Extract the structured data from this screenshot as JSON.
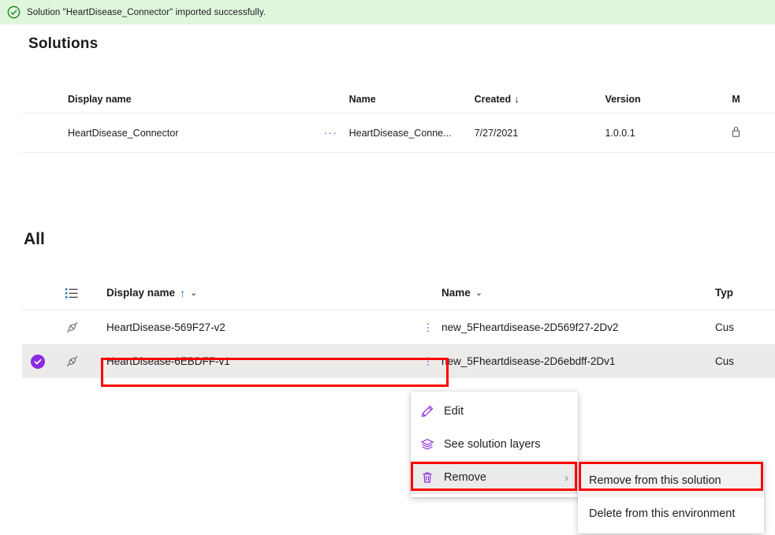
{
  "banner": {
    "icon": "check-circle-outline-icon",
    "message": "Solution \"HeartDisease_Connector\" imported successfully.",
    "background": "#dff6dd"
  },
  "page": {
    "title": "Solutions"
  },
  "solutions_table": {
    "columns": [
      "Display name",
      "Name",
      "Created",
      "Version",
      "M"
    ],
    "sort_indicator": "↓",
    "rows": [
      {
        "display_name": "HeartDisease_Connector",
        "overflow": "···",
        "name": "HeartDisease_Conne...",
        "created": "7/27/2021",
        "version": "1.0.0.1",
        "managed": ""
      }
    ]
  },
  "all_section": {
    "title": "All",
    "columns": {
      "sort_icon": "sort-list-icon",
      "display_name": "Display name",
      "display_sort": "↑",
      "display_chevron": "⌄",
      "name": "Name",
      "name_chevron": "⌄",
      "type": "Typ"
    },
    "rows": [
      {
        "selected": false,
        "pin_icon": "connector-icon",
        "display_name": "HeartDisease-569F27-v2",
        "kebab": "⋮",
        "name": "new_5Fheartdisease-2D569f27-2Dv2",
        "type": "Cus"
      },
      {
        "selected": true,
        "check_icon": "selected-check-icon",
        "pin_icon": "connector-icon",
        "display_name": "HeartDisease-6EBDFF-v1",
        "kebab": "⋮",
        "name": "new_5Fheartdisease-2D6ebdff-2Dv1",
        "type": "Cus"
      }
    ]
  },
  "context_menu": {
    "items": [
      {
        "icon": "pencil-icon",
        "label": "Edit",
        "submenu": false
      },
      {
        "icon": "layers-icon",
        "label": "See solution layers",
        "submenu": false
      },
      {
        "icon": "trash-icon",
        "label": "Remove",
        "submenu": true,
        "chevron": "›",
        "highlighted": true
      }
    ]
  },
  "context_submenu": {
    "items": [
      {
        "label": "Remove from this solution",
        "highlighted": true
      },
      {
        "label": "Delete from this environment",
        "highlighted": false
      }
    ]
  },
  "colors": {
    "accent_purple": "#8a2be2",
    "banner_green": "#dff6dd",
    "selected_row": "#edebe9",
    "annotation_red": "#ff0000",
    "sort_blue": "#0f6cbd"
  }
}
